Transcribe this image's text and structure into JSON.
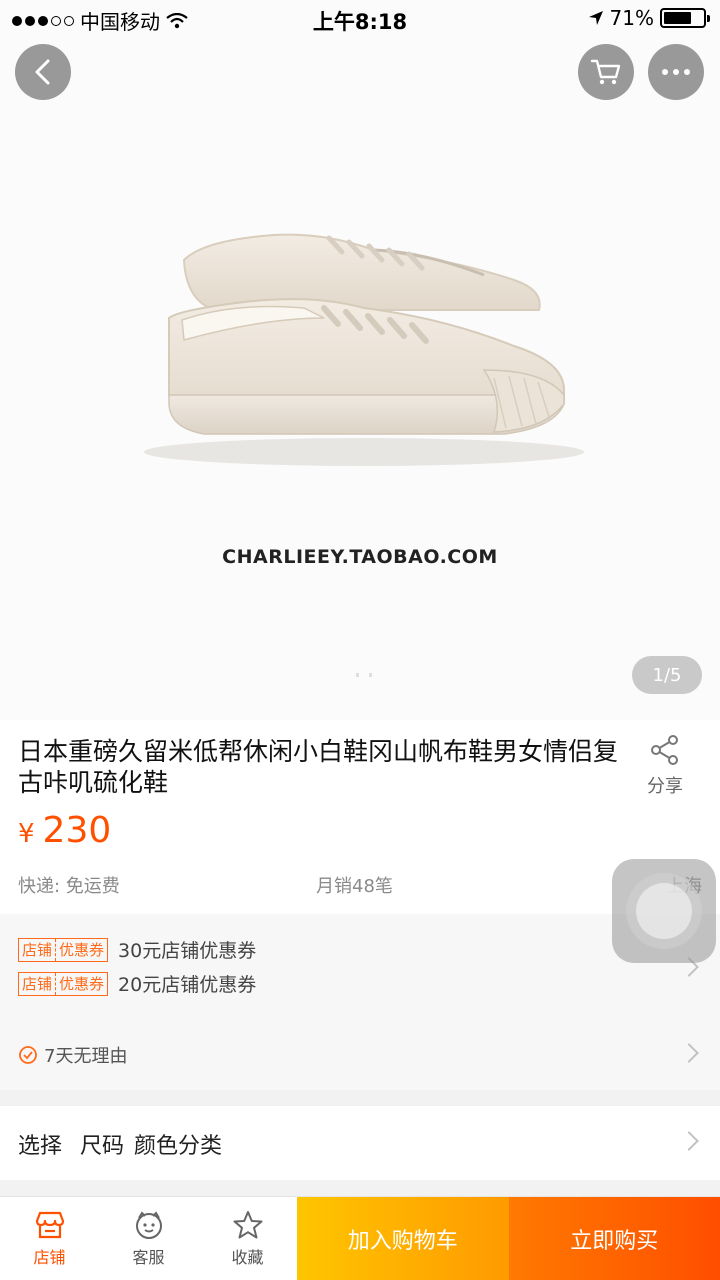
{
  "status_bar": {
    "carrier": "中国移动",
    "time": "上午8:18",
    "battery_percent": "71%",
    "battery_level": 0.71,
    "signal_bars_filled": 3,
    "signal_bars_total": 5
  },
  "hero": {
    "watermark": "CHARLIEEY.TAOBAO.COM",
    "pager": "1/5",
    "icons": {
      "back": "chevron-left-icon",
      "cart": "cart-icon",
      "more": "more-icon"
    }
  },
  "product": {
    "title": "日本重磅久留米低帮休闲小白鞋冈山帆布鞋男女情侣复古咔叽硫化鞋",
    "share_label": "分享",
    "currency": "¥",
    "price": "230",
    "shipping": "快递: 免运费",
    "monthly_sales": "月销48笔",
    "location": "上海",
    "accent_color": "#ff5000"
  },
  "coupons": {
    "tag_store": "店铺",
    "tag_coupon": "优惠券",
    "items": [
      {
        "text": "30元店铺优惠券"
      },
      {
        "text": "20元店铺优惠券"
      }
    ],
    "guarantee": "7天无理由"
  },
  "options": {
    "label": "选择",
    "size": "尺码",
    "color": "颜色分类"
  },
  "bottom_bar": {
    "tabs": [
      {
        "label": "店铺",
        "icon": "store-icon"
      },
      {
        "label": "客服",
        "icon": "service-icon"
      },
      {
        "label": "收藏",
        "icon": "star-icon"
      }
    ],
    "add_to_cart": "加入购物车",
    "buy_now": "立即购买"
  }
}
